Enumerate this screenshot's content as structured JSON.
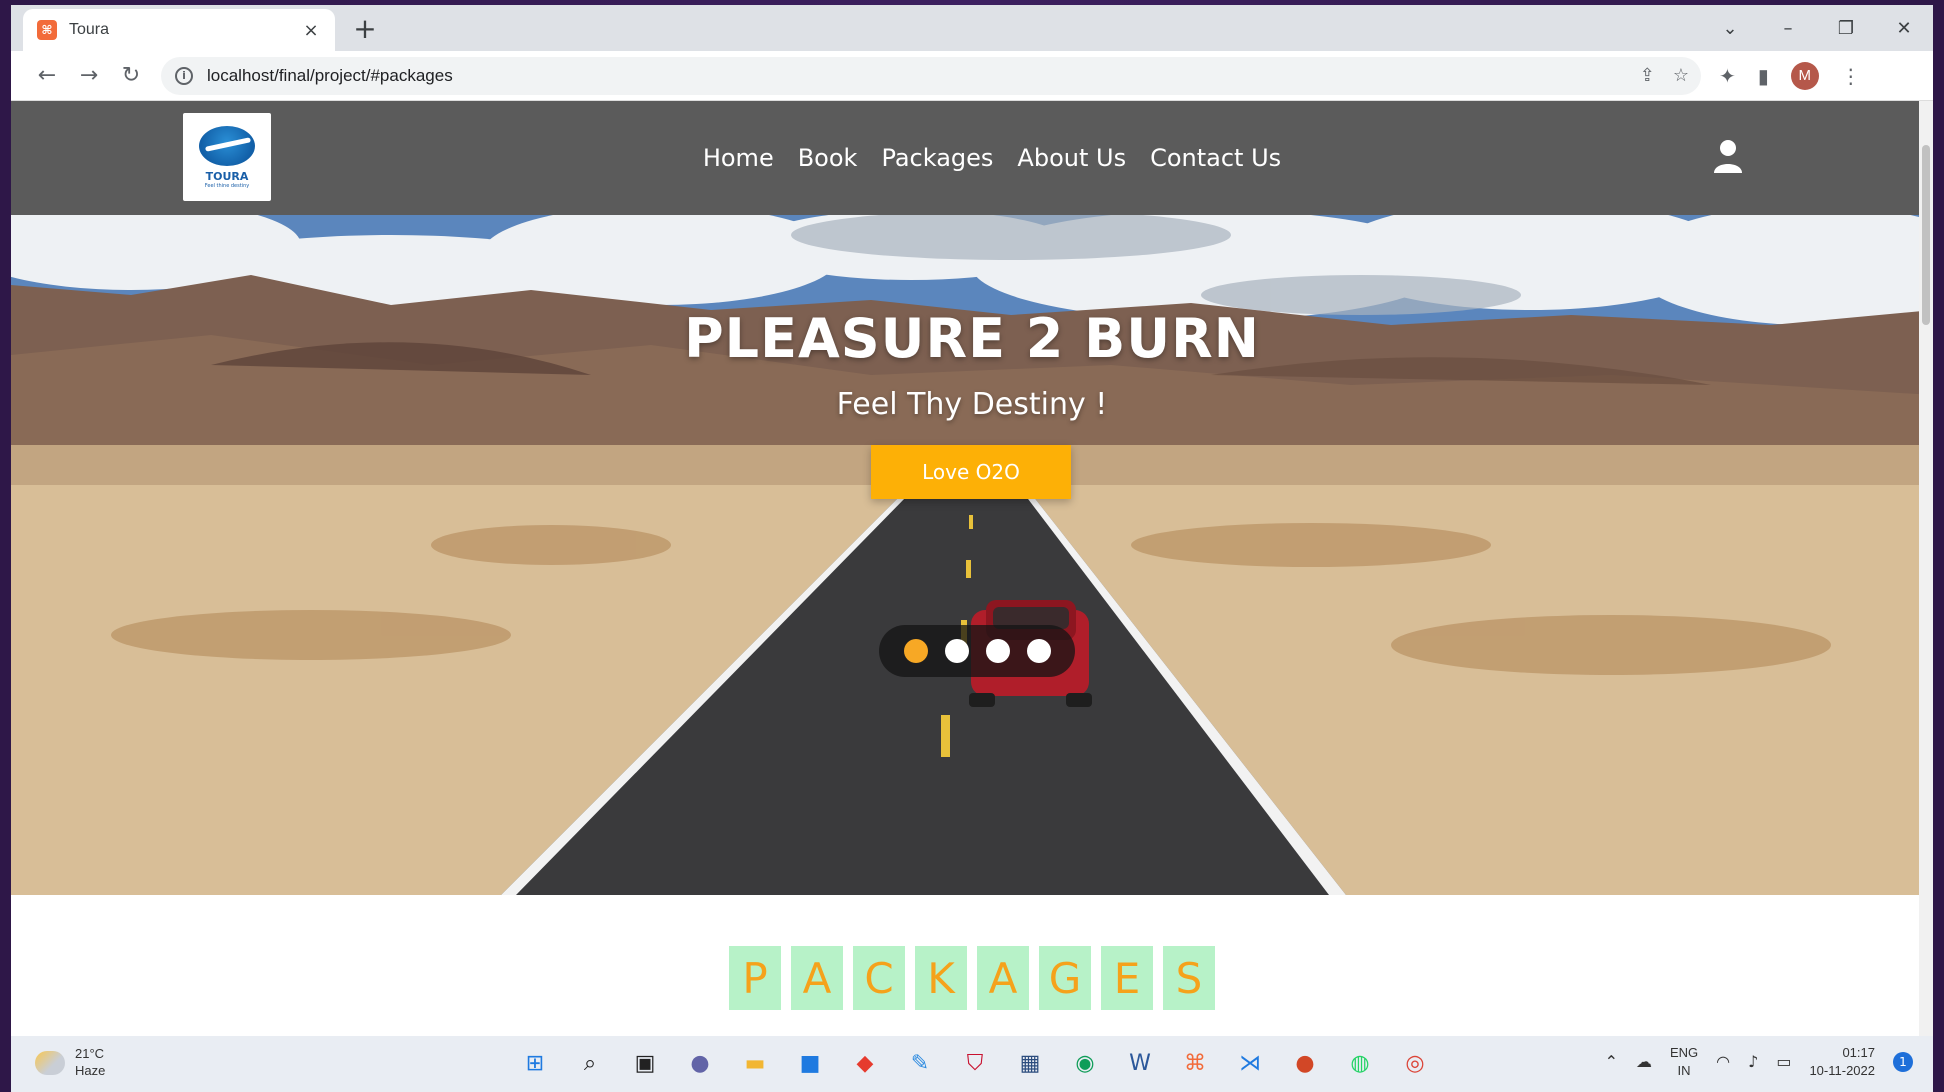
{
  "browser": {
    "tab_title": "Toura",
    "tab_close": "×",
    "new_tab": "+",
    "url": "localhost/final/project/#packages",
    "profile_initial": "M",
    "window_controls": [
      "⌄",
      "–",
      "❐",
      "✕"
    ]
  },
  "site": {
    "nav": [
      {
        "label": "Home"
      },
      {
        "label": "Book"
      },
      {
        "label": "Packages"
      },
      {
        "label": "About Us"
      },
      {
        "label": "Contact Us"
      }
    ],
    "logo_text": "TOURA",
    "logo_tagline": "Feel thine destiny"
  },
  "hero": {
    "title": "PLEASURE 2 BURN",
    "subtitle": "Feel Thy Destiny !",
    "button_label": "Love O2O",
    "slides_count": 4,
    "active_slide": 0
  },
  "packages": {
    "letters": [
      "P",
      "A",
      "C",
      "K",
      "A",
      "G",
      "E",
      "S"
    ]
  },
  "taskbar": {
    "weather_temp": "21°C",
    "weather_desc": "Haze",
    "language": "ENG",
    "region": "IN",
    "time": "01:17",
    "date": "10-11-2022",
    "notification_count": "1"
  },
  "colors": {
    "nav_bg": "#5b5b5b",
    "accent": "#fdb006",
    "dot_active": "#f7a825",
    "packages_bg": "#b7f2c8",
    "packages_fg": "#f5a21b"
  }
}
